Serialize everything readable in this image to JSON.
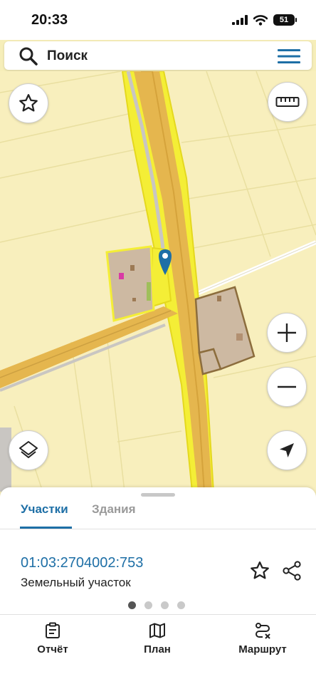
{
  "status_bar": {
    "time": "20:33",
    "battery": "51"
  },
  "search": {
    "label": "Поиск"
  },
  "map": {
    "colors": {
      "background": "#f8efbd",
      "road": "#e5b64e",
      "highlight": "#f4ee36",
      "building": "#cdb9a2",
      "pin": "#1e6fa6"
    }
  },
  "sheet": {
    "tabs": [
      {
        "label": "Участки",
        "active": true
      },
      {
        "label": "Здания",
        "active": false
      }
    ],
    "cadastral_number": "01:03:2704002:753",
    "parcel_type": "Земельный участок",
    "page_count": 4,
    "active_page": 1
  },
  "bottom_nav": {
    "items": [
      {
        "label": "Отчёт",
        "icon": "report-icon"
      },
      {
        "label": "План",
        "icon": "map-icon"
      },
      {
        "label": "Маршрут",
        "icon": "route-icon"
      }
    ]
  },
  "accent_color": "#1e6fa6"
}
